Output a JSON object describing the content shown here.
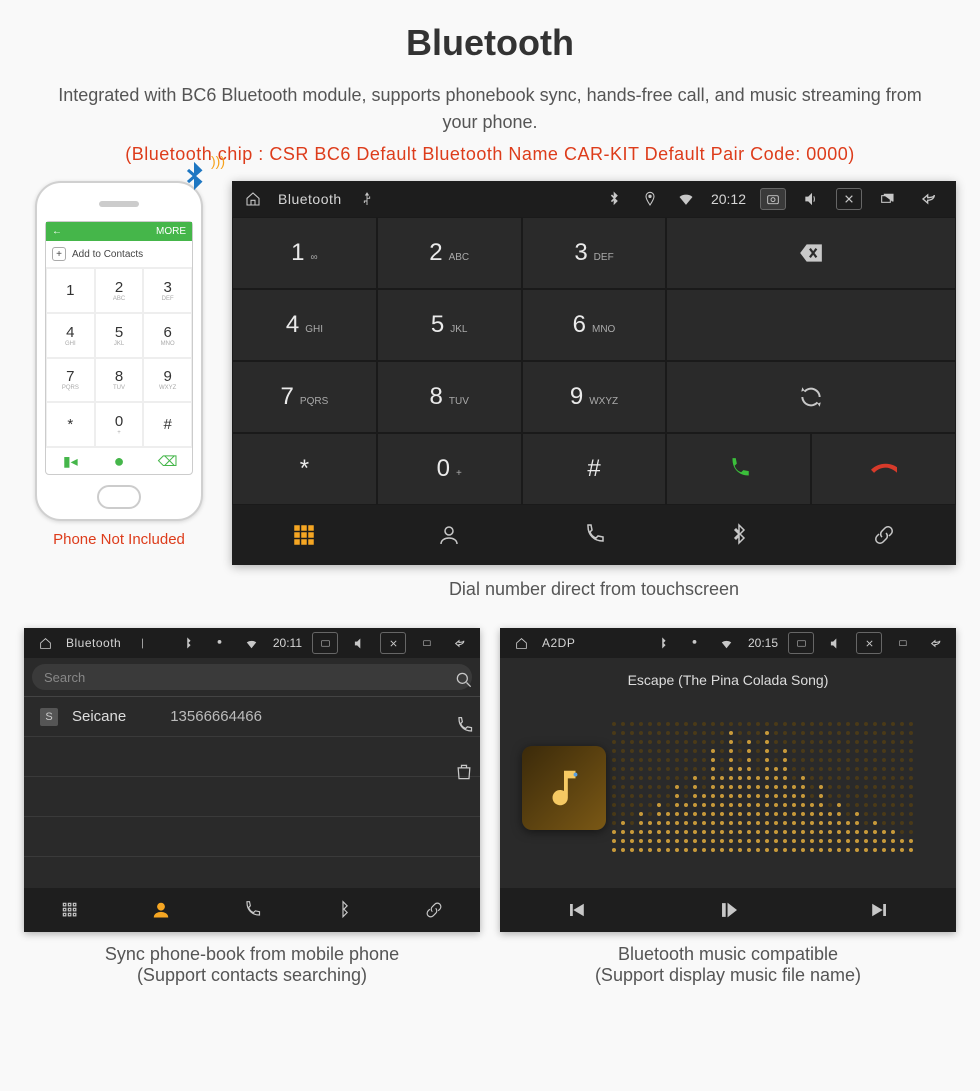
{
  "title": "Bluetooth",
  "subtitle": "Integrated with BC6 Bluetooth module, supports phonebook sync, hands-free call, and music streaming from your phone.",
  "specs": "(Bluetooth chip : CSR BC6    Default Bluetooth Name CAR-KIT    Default Pair Code: 0000)",
  "phone": {
    "caption": "Phone Not Included",
    "topbar": {
      "back_icon": "arrow-left",
      "more_label": "MORE"
    },
    "add_contacts_label": "Add to Contacts",
    "keypad": [
      {
        "d": "1",
        "s": ""
      },
      {
        "d": "2",
        "s": "ABC"
      },
      {
        "d": "3",
        "s": "DEF"
      },
      {
        "d": "4",
        "s": "GHI"
      },
      {
        "d": "5",
        "s": "JKL"
      },
      {
        "d": "6",
        "s": "MNO"
      },
      {
        "d": "7",
        "s": "PQRS"
      },
      {
        "d": "8",
        "s": "TUV"
      },
      {
        "d": "9",
        "s": "WXYZ"
      },
      {
        "d": "*",
        "s": ""
      },
      {
        "d": "0",
        "s": "+"
      },
      {
        "d": "#",
        "s": ""
      }
    ]
  },
  "dialer": {
    "caption": "Dial number direct from touchscreen",
    "status": {
      "title": "Bluetooth",
      "time": "20:12"
    },
    "keys": [
      {
        "d": "1",
        "s": "∞"
      },
      {
        "d": "2",
        "s": "ABC"
      },
      {
        "d": "3",
        "s": "DEF"
      },
      {
        "d": "4",
        "s": "GHI"
      },
      {
        "d": "5",
        "s": "JKL"
      },
      {
        "d": "6",
        "s": "MNO"
      },
      {
        "d": "7",
        "s": "PQRS"
      },
      {
        "d": "8",
        "s": "TUV"
      },
      {
        "d": "9",
        "s": "WXYZ"
      },
      {
        "d": "*",
        "s": ""
      },
      {
        "d": "0",
        "s": "+"
      },
      {
        "d": "#",
        "s": ""
      }
    ]
  },
  "phonebook": {
    "caption_line1": "Sync phone-book from mobile phone",
    "caption_line2": "(Support contacts searching)",
    "status": {
      "title": "Bluetooth",
      "time": "20:11"
    },
    "search_placeholder": "Search",
    "contacts": [
      {
        "initial": "S",
        "name": "Seicane",
        "number": "13566664466"
      }
    ]
  },
  "a2dp": {
    "caption_line1": "Bluetooth music compatible",
    "caption_line2": "(Support display music file name)",
    "status": {
      "title": "A2DP",
      "time": "20:15"
    },
    "track_title": "Escape (The Pina Colada Song)"
  }
}
